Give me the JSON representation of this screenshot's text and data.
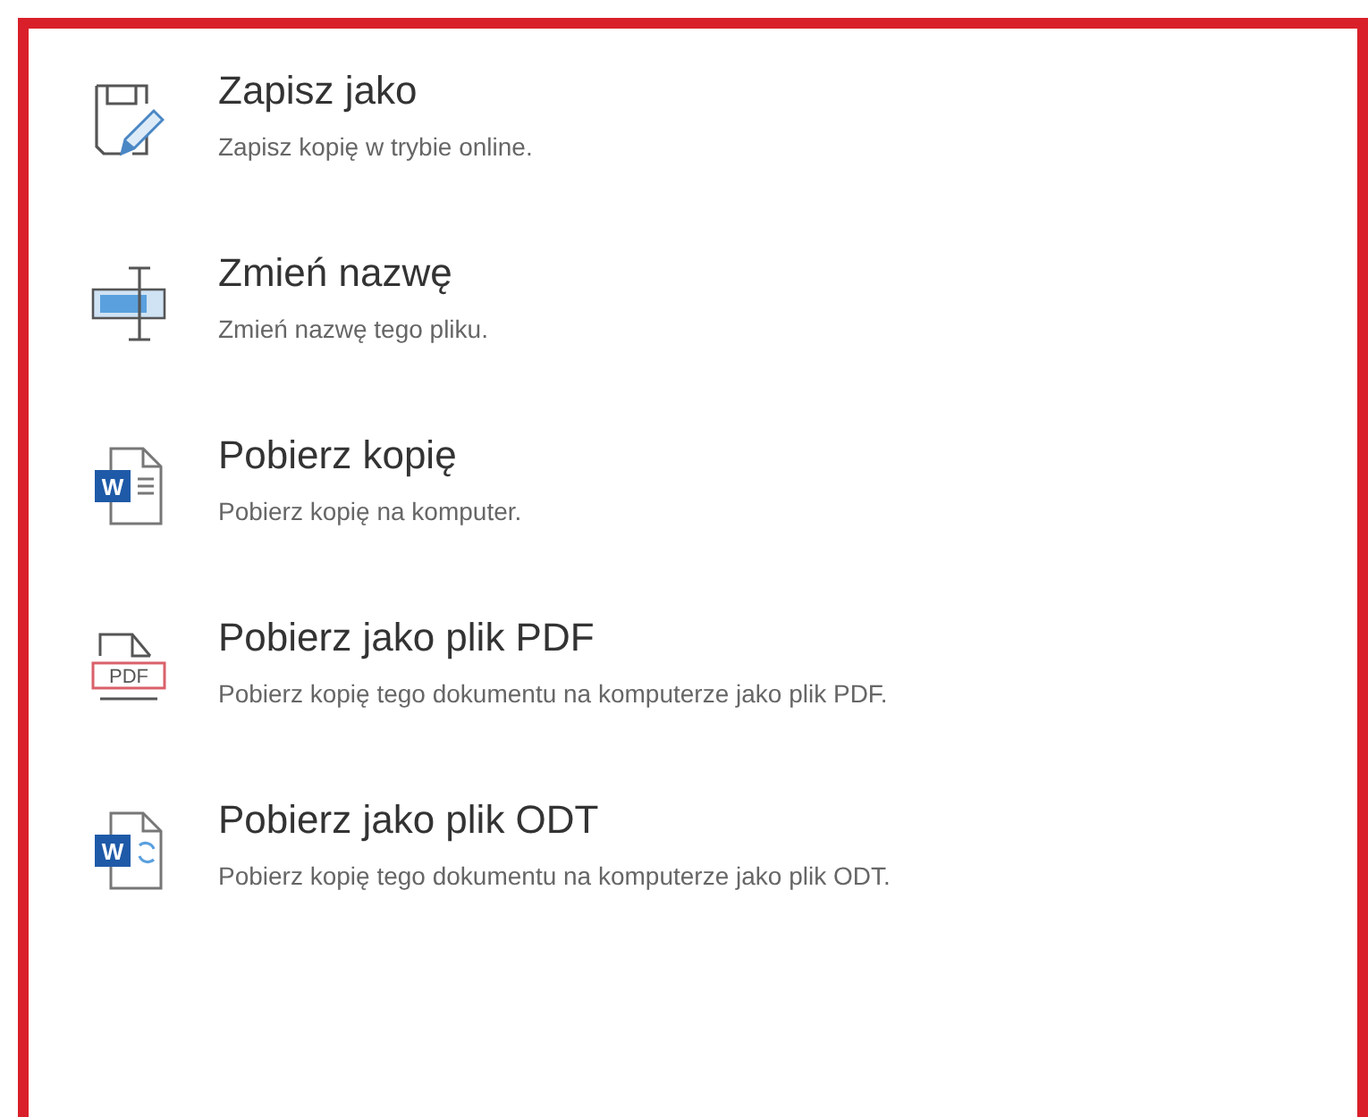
{
  "items": [
    {
      "kind": "save-as",
      "title": "Zapisz jako",
      "description": "Zapisz kopię w trybie online."
    },
    {
      "kind": "rename",
      "title": "Zmień nazwę",
      "description": "Zmień nazwę tego pliku."
    },
    {
      "kind": "word",
      "badge": "W",
      "title": "Pobierz kopię",
      "description": "Pobierz kopię na komputer."
    },
    {
      "kind": "pdf",
      "badge": "PDF",
      "title": "Pobierz jako plik PDF",
      "description": "Pobierz kopię tego dokumentu na komputerze jako plik PDF."
    },
    {
      "kind": "odt",
      "badge": "W",
      "title": "Pobierz jako plik ODT",
      "description": "Pobierz kopię tego dokumentu na komputerze jako plik ODT."
    }
  ]
}
